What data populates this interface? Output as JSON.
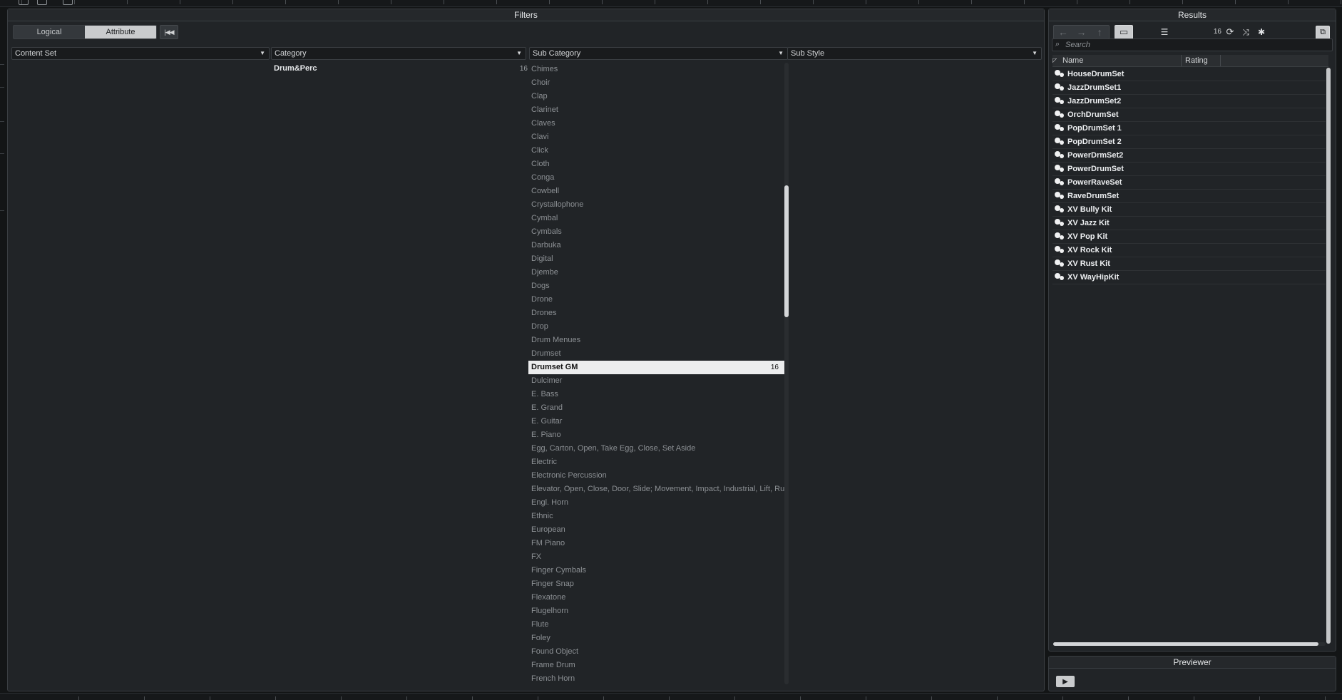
{
  "filters": {
    "title": "Filters",
    "mode_tabs": [
      "Logical",
      "Attribute"
    ],
    "active_tab": "Attribute",
    "reset_icon": "reset-icon",
    "columns": [
      {
        "label": "Content Set"
      },
      {
        "label": "Category"
      },
      {
        "label": "Sub Category"
      },
      {
        "label": "Sub Style"
      }
    ],
    "category_items": [
      {
        "label": "Drum&Perc",
        "count": "16"
      }
    ],
    "subcategory_items": [
      {
        "label": "Chimes"
      },
      {
        "label": "Choir"
      },
      {
        "label": "Clap"
      },
      {
        "label": "Clarinet"
      },
      {
        "label": "Claves"
      },
      {
        "label": "Clavi"
      },
      {
        "label": "Click"
      },
      {
        "label": "Cloth"
      },
      {
        "label": "Conga"
      },
      {
        "label": "Cowbell"
      },
      {
        "label": "Crystallophone"
      },
      {
        "label": "Cymbal"
      },
      {
        "label": "Cymbals"
      },
      {
        "label": "Darbuka"
      },
      {
        "label": "Digital"
      },
      {
        "label": "Djembe"
      },
      {
        "label": "Dogs"
      },
      {
        "label": "Drone"
      },
      {
        "label": "Drones"
      },
      {
        "label": "Drop"
      },
      {
        "label": "Drum Menues"
      },
      {
        "label": "Drumset"
      },
      {
        "label": "Drumset GM",
        "count": "16",
        "selected": true
      },
      {
        "label": "Dulcimer"
      },
      {
        "label": "E. Bass"
      },
      {
        "label": "E. Grand"
      },
      {
        "label": "E. Guitar"
      },
      {
        "label": "E. Piano"
      },
      {
        "label": "Egg, Carton, Open, Take Egg, Close, Set Aside"
      },
      {
        "label": "Electric"
      },
      {
        "label": "Electronic Percussion"
      },
      {
        "label": "Elevator, Open, Close, Door, Slide; Movement, Impact, Industrial, Lift, Ru"
      },
      {
        "label": "Engl. Horn"
      },
      {
        "label": "Ethnic"
      },
      {
        "label": "European"
      },
      {
        "label": "FM Piano"
      },
      {
        "label": "FX"
      },
      {
        "label": "Finger Cymbals"
      },
      {
        "label": "Finger Snap"
      },
      {
        "label": "Flexatone"
      },
      {
        "label": "Flugelhorn"
      },
      {
        "label": "Flute"
      },
      {
        "label": "Foley"
      },
      {
        "label": "Found Object"
      },
      {
        "label": "Frame Drum"
      },
      {
        "label": "French Horn"
      }
    ]
  },
  "results": {
    "title": "Results",
    "count": "16",
    "search_placeholder": "Search",
    "columns": [
      "Name",
      "Rating"
    ],
    "items": [
      "HouseDrumSet",
      "JazzDrumSet1",
      "JazzDrumSet2",
      "OrchDrumSet",
      "PopDrumSet 1",
      "PopDrumSet 2",
      "PowerDrmSet2",
      "PowerDrumSet",
      "PowerRaveSet",
      "RaveDrumSet",
      "XV Bully Kit",
      "XV Jazz Kit",
      "XV Pop Kit",
      "XV Rock Kit",
      "XV Rust Kit",
      "XV WayHipKit"
    ],
    "toolbar_icons": [
      "back-arrow-icon",
      "forward-arrow-icon",
      "up-arrow-icon",
      "folder-icon",
      "list-view-icon",
      "refresh-icon",
      "shuffle-icon",
      "gear-icon",
      "export-icon"
    ]
  },
  "previewer": {
    "title": "Previewer",
    "button_icon": "preview-play-icon"
  },
  "colors": {
    "panel_bg": "#212427",
    "selected_row_bg": "#ecedee",
    "active_tab_bg": "#c9cbcd",
    "muted_text": "#8c9094"
  }
}
